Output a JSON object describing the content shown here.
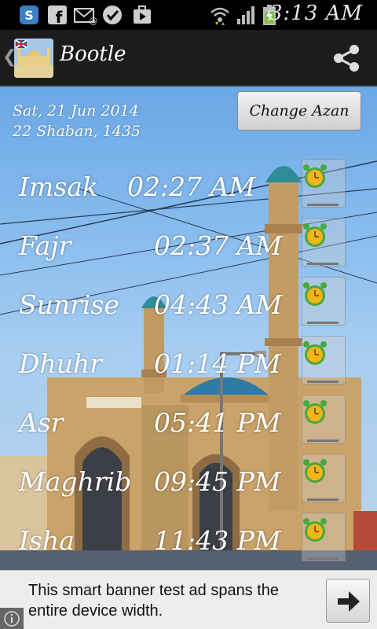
{
  "status_bar": {
    "time": "3:13 AM",
    "icons": [
      "skype-icon",
      "facebook-icon",
      "gmail-icon",
      "check-icon",
      "youtube-icon",
      "wifi-icon",
      "signal-icon",
      "battery-charging-icon"
    ]
  },
  "action_bar": {
    "title": "Bootle",
    "share_icon": "share-icon"
  },
  "header": {
    "gregorian_date": "Sat, 21 Jun 2014",
    "hijri_date": "22 Shaban, 1435",
    "change_azan_label": "Change Azan"
  },
  "prayers": [
    {
      "name": "Imsak",
      "time": "02:27 AM"
    },
    {
      "name": "Fajr",
      "time": "02:37 AM"
    },
    {
      "name": "Sunrise",
      "time": "04:43 AM"
    },
    {
      "name": "Dhuhr",
      "time": "01:14 PM"
    },
    {
      "name": "Asr",
      "time": "05:41 PM"
    },
    {
      "name": "Maghrib",
      "time": "09:45 PM"
    },
    {
      "name": "Isha",
      "time": "11:43 PM"
    }
  ],
  "ad": {
    "text": "This smart banner test ad spans the entire device width."
  },
  "colors": {
    "text": "#ffffff",
    "alarm": "#f2b51a",
    "alarm_ring": "#48a83c"
  }
}
